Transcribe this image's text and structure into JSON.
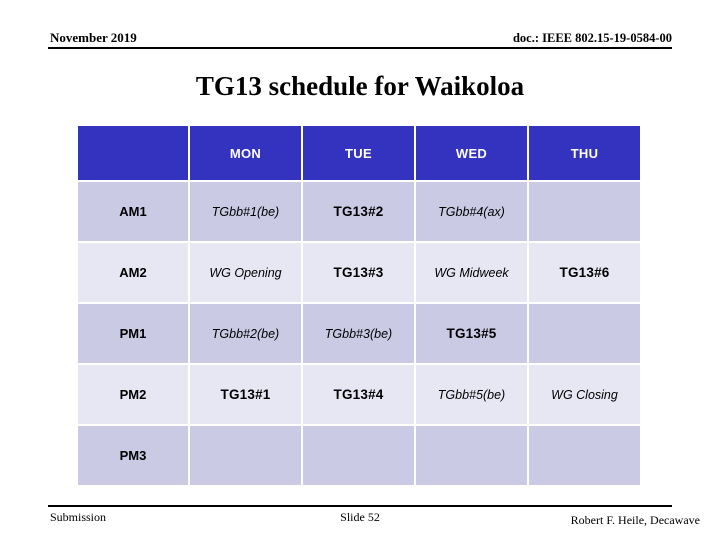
{
  "header": {
    "left": "November 2019",
    "right": "doc.: IEEE 802.15-19-0584-00"
  },
  "title": "TG13 schedule for Waikoloa",
  "table": {
    "corner_label": "",
    "columns": [
      "MON",
      "TUE",
      "WED",
      "THU"
    ],
    "rows": [
      {
        "label": "AM1",
        "shade": "dark",
        "cells": [
          {
            "text": "TGbb#1(be)",
            "style": "note"
          },
          {
            "text": "TG13#2",
            "style": "tg"
          },
          {
            "text": "TGbb#4(ax)",
            "style": "note"
          },
          {
            "text": "",
            "style": "empty"
          }
        ]
      },
      {
        "label": "AM2",
        "shade": "light",
        "cells": [
          {
            "text": "WG Opening",
            "style": "note"
          },
          {
            "text": "TG13#3",
            "style": "tg"
          },
          {
            "text": "WG Midweek",
            "style": "note"
          },
          {
            "text": "TG13#6",
            "style": "tg"
          }
        ]
      },
      {
        "label": "PM1",
        "shade": "dark",
        "cells": [
          {
            "text": "TGbb#2(be)",
            "style": "note"
          },
          {
            "text": "TGbb#3(be)",
            "style": "note"
          },
          {
            "text": "TG13#5",
            "style": "tg"
          },
          {
            "text": "",
            "style": "empty"
          }
        ]
      },
      {
        "label": "PM2",
        "shade": "light",
        "cells": [
          {
            "text": "TG13#1",
            "style": "tg"
          },
          {
            "text": "TG13#4",
            "style": "tg"
          },
          {
            "text": "TGbb#5(be)",
            "style": "note"
          },
          {
            "text": "WG Closing",
            "style": "note"
          }
        ]
      },
      {
        "label": "PM3",
        "shade": "dark",
        "cells": [
          {
            "text": "",
            "style": "empty"
          },
          {
            "text": "",
            "style": "empty"
          },
          {
            "text": "",
            "style": "empty"
          },
          {
            "text": "",
            "style": "empty"
          }
        ]
      }
    ]
  },
  "footer": {
    "left": "Submission",
    "center": "Slide 52",
    "right": "Robert F. Heile, Decawave"
  },
  "colors": {
    "header_blue": "#3333BF",
    "row_dark": "#CACAE5",
    "row_light": "#E7E7F4",
    "text": "#000000",
    "header_text": "#FFFFFF"
  }
}
